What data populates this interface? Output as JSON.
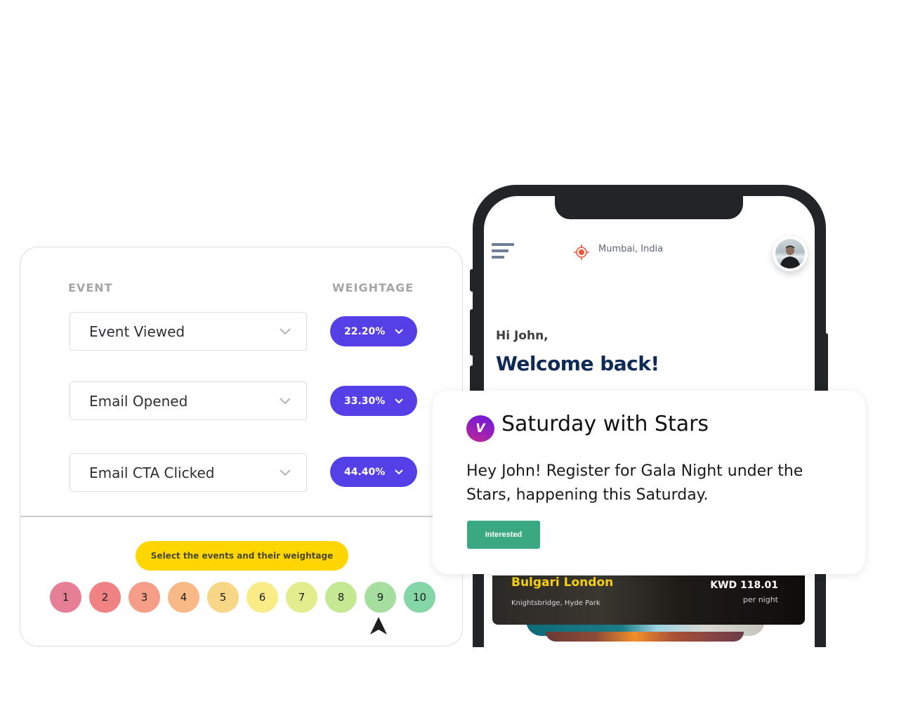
{
  "event_panel": {
    "headers": {
      "event": "EVENT",
      "weightage": "WEIGHTAGE"
    },
    "rows": [
      {
        "event": "Event Viewed",
        "weightage": "22.20%"
      },
      {
        "event": "Email Opened",
        "weightage": "33.30%"
      },
      {
        "event": "Email CTA Clicked",
        "weightage": "44.40%"
      }
    ],
    "hint": "Select the events and their weightage",
    "scale": [
      {
        "label": "1",
        "color": "#e67f96"
      },
      {
        "label": "2",
        "color": "#f08283"
      },
      {
        "label": "3",
        "color": "#f59d87"
      },
      {
        "label": "4",
        "color": "#f8b986"
      },
      {
        "label": "5",
        "color": "#f8d688"
      },
      {
        "label": "6",
        "color": "#f9eb86"
      },
      {
        "label": "7",
        "color": "#e3ed8e"
      },
      {
        "label": "8",
        "color": "#c5e993"
      },
      {
        "label": "9",
        "color": "#a6dea0"
      },
      {
        "label": "10",
        "color": "#84d6a6"
      }
    ],
    "selected_scale": "9",
    "accent_color": "#5540e8",
    "hint_color": "#ffd600"
  },
  "phone": {
    "location": "Mumbai, India",
    "greeting": "Hi John,",
    "welcome": "Welcome back!",
    "hotel": {
      "name": "Bulgari London",
      "location": "Knightsbridge, Hyde Park",
      "price": "KWD 118.01",
      "price_unit": "per night"
    }
  },
  "notification": {
    "brand_initial": "V",
    "title": "Saturday with Stars",
    "body": "Hey John! Register for Gala Night under the Stars, happening this Saturday.",
    "cta": "Interested",
    "cta_color": "#3aa982"
  }
}
